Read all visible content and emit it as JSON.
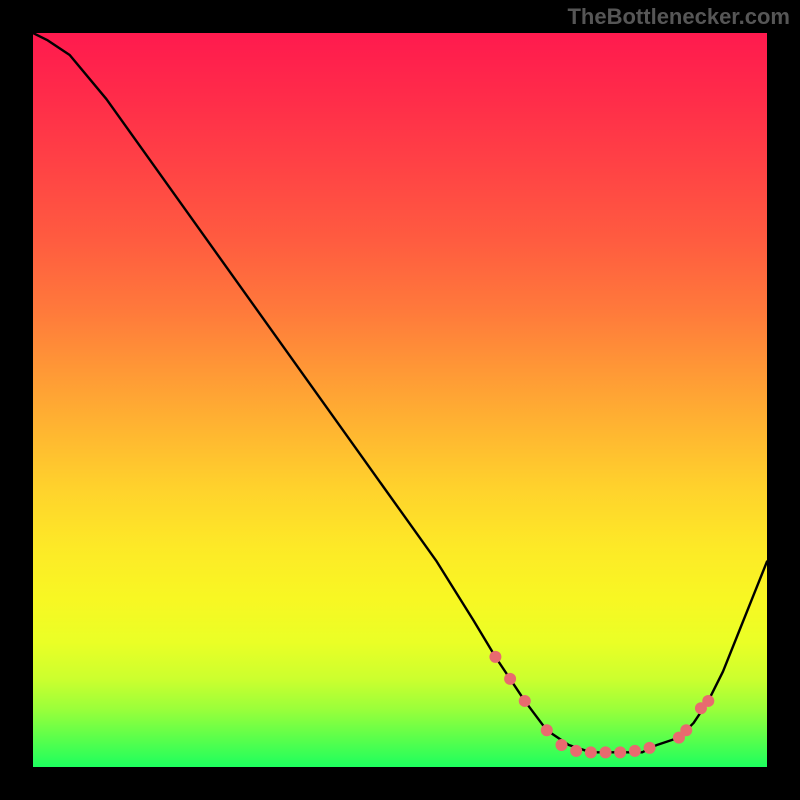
{
  "attribution": "TheBottlenecker.com",
  "colors": {
    "marker_fill": "#e86a6f",
    "marker_stroke": "#b84a50",
    "curve_stroke": "#000000"
  },
  "chart_data": {
    "type": "line",
    "title": "",
    "xlabel": "",
    "ylabel": "",
    "xlim": [
      0,
      100
    ],
    "ylim": [
      0,
      100
    ],
    "series": [
      {
        "name": "curve",
        "x": [
          0,
          2,
          5,
          10,
          15,
          20,
          25,
          30,
          35,
          40,
          45,
          50,
          55,
          60,
          63,
          65,
          67,
          70,
          73,
          76,
          80,
          83,
          85,
          88,
          90,
          92,
          94,
          96,
          98,
          100
        ],
        "values": [
          100,
          99,
          97,
          91,
          84,
          77,
          70,
          63,
          56,
          49,
          42,
          35,
          28,
          20,
          15,
          12,
          9,
          5,
          3,
          2,
          2,
          2,
          3,
          4,
          6,
          9,
          13,
          18,
          23,
          28
        ]
      }
    ],
    "markers": [
      {
        "x": 63.0,
        "y": 15.0
      },
      {
        "x": 65.0,
        "y": 12.0
      },
      {
        "x": 67.0,
        "y": 9.0
      },
      {
        "x": 70.0,
        "y": 5.0
      },
      {
        "x": 72.0,
        "y": 3.0
      },
      {
        "x": 74.0,
        "y": 2.2
      },
      {
        "x": 76.0,
        "y": 2.0
      },
      {
        "x": 78.0,
        "y": 2.0
      },
      {
        "x": 80.0,
        "y": 2.0
      },
      {
        "x": 82.0,
        "y": 2.2
      },
      {
        "x": 84.0,
        "y": 2.6
      },
      {
        "x": 88.0,
        "y": 4.0
      },
      {
        "x": 89.0,
        "y": 5.0
      },
      {
        "x": 91.0,
        "y": 8.0
      },
      {
        "x": 92.0,
        "y": 9.0
      }
    ]
  }
}
